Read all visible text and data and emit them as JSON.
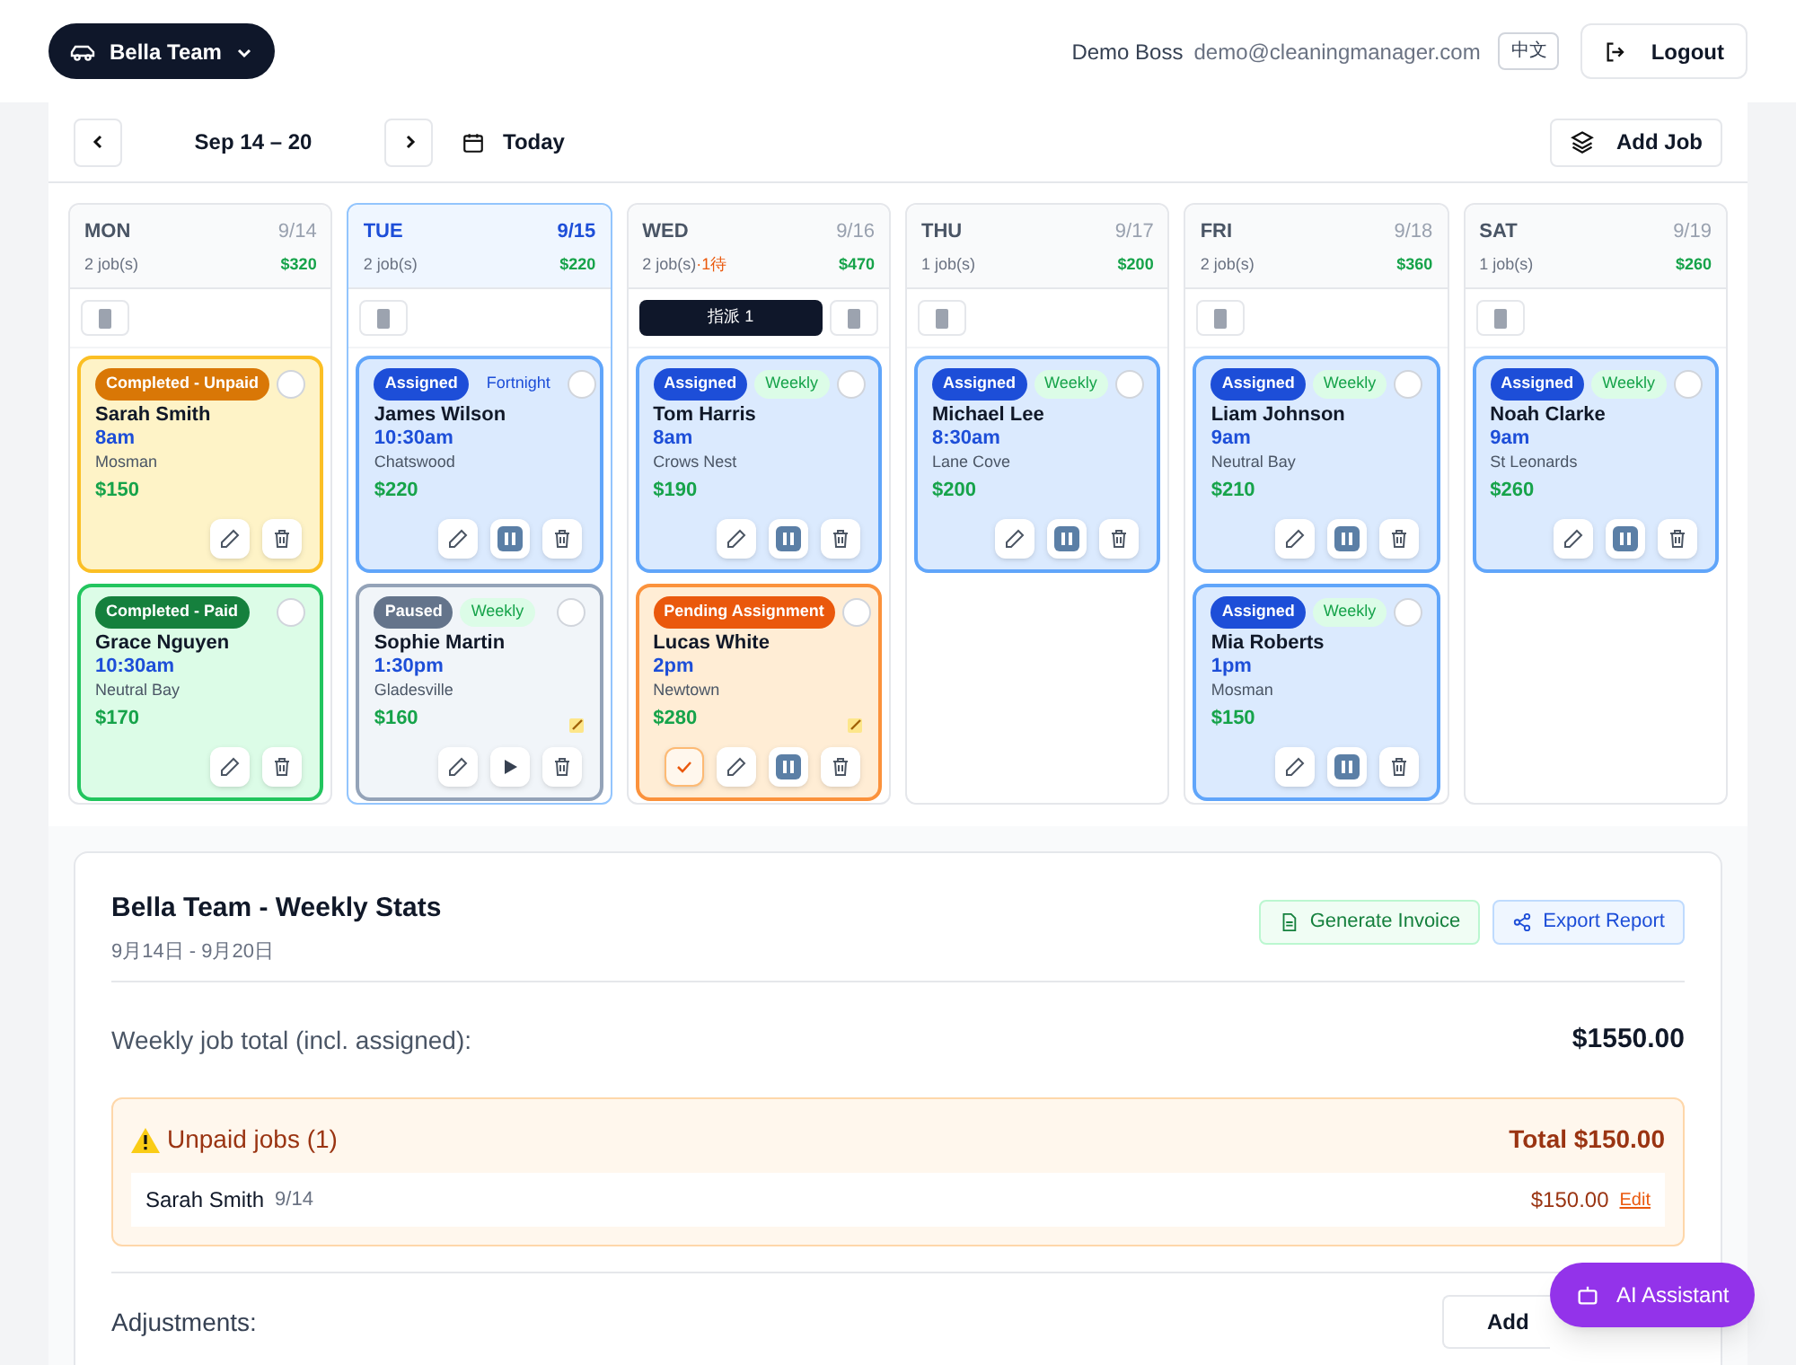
{
  "header": {
    "team": "Bella Team",
    "user": "Demo Boss",
    "email": "demo@cleaningmanager.com",
    "language": "中文",
    "logout": "Logout"
  },
  "toolbar": {
    "range": "Sep 14 – 20",
    "today": "Today",
    "add_job": "Add Job"
  },
  "days": [
    {
      "day": "MON",
      "date": "9/14",
      "jobs": "2 job(s)",
      "total": "$320",
      "selected": false,
      "jobs_list": [
        {
          "kind": "completed_unpaid",
          "status": "Completed - Unpaid",
          "name": "Sarah Smith",
          "time": "8am",
          "suburb": "Mosman",
          "price": "$150",
          "note": false,
          "selected": false,
          "actions": [
            {
              "kind": "edit"
            },
            {
              "kind": "delete"
            }
          ]
        },
        {
          "kind": "completed_paid",
          "status": "Completed - Paid",
          "name": "Grace Nguyen",
          "time": "10:30am",
          "suburb": "Neutral Bay",
          "price": "$170",
          "note": false,
          "selected": false,
          "actions": [
            {
              "kind": "edit"
            },
            {
              "kind": "delete"
            }
          ]
        }
      ]
    },
    {
      "day": "TUE",
      "date": "9/15",
      "jobs": "2 job(s)",
      "total": "$220",
      "selected": true,
      "jobs_list": [
        {
          "kind": "assigned",
          "status": "Assigned",
          "recurrence": "Fortnight",
          "name": "James Wilson",
          "time": "10:30am",
          "suburb": "Chatswood",
          "price": "$220",
          "note": false,
          "selected": false,
          "actions": [
            {
              "kind": "edit"
            },
            {
              "kind": "pause"
            },
            {
              "kind": "delete"
            }
          ]
        },
        {
          "kind": "paused",
          "status": "Paused",
          "recurrence": "Weekly",
          "name": "Sophie Martin",
          "time": "1:30pm",
          "suburb": "Gladesville",
          "price": "$160",
          "note": true,
          "selected": false,
          "actions": [
            {
              "kind": "edit"
            },
            {
              "kind": "play"
            },
            {
              "kind": "delete"
            }
          ]
        }
      ]
    },
    {
      "day": "WED",
      "date": "9/16",
      "jobs": "2 job(s)",
      "pending": "·1待",
      "total": "$470",
      "selected": false,
      "assign": "指派 1",
      "jobs_list": [
        {
          "kind": "assigned",
          "status": "Assigned",
          "recurrence": "Weekly",
          "name": "Tom Harris",
          "time": "8am",
          "suburb": "Crows Nest",
          "price": "$190",
          "note": false,
          "selected": false,
          "actions": [
            {
              "kind": "edit"
            },
            {
              "kind": "pause"
            },
            {
              "kind": "delete"
            }
          ]
        },
        {
          "kind": "pending",
          "status": "Pending Assignment",
          "name": "Lucas White",
          "time": "2pm",
          "suburb": "Newtown",
          "price": "$280",
          "note": true,
          "selected": false,
          "actions": [
            {
              "kind": "approve"
            },
            {
              "kind": "edit"
            },
            {
              "kind": "pause"
            },
            {
              "kind": "delete"
            }
          ]
        }
      ]
    },
    {
      "day": "THU",
      "date": "9/17",
      "jobs": "1 job(s)",
      "total": "$200",
      "selected": false,
      "jobs_list": [
        {
          "kind": "assigned",
          "status": "Assigned",
          "recurrence": "Weekly",
          "name": "Michael Lee",
          "time": "8:30am",
          "suburb": "Lane Cove",
          "price": "$200",
          "note": false,
          "selected": false,
          "actions": [
            {
              "kind": "edit"
            },
            {
              "kind": "pause"
            },
            {
              "kind": "delete"
            }
          ]
        }
      ]
    },
    {
      "day": "FRI",
      "date": "9/18",
      "jobs": "2 job(s)",
      "total": "$360",
      "selected": false,
      "jobs_list": [
        {
          "kind": "assigned",
          "status": "Assigned",
          "recurrence": "Weekly",
          "name": "Liam Johnson",
          "time": "9am",
          "suburb": "Neutral Bay",
          "price": "$210",
          "note": false,
          "selected": false,
          "actions": [
            {
              "kind": "edit"
            },
            {
              "kind": "pause"
            },
            {
              "kind": "delete"
            }
          ]
        },
        {
          "kind": "assigned",
          "status": "Assigned",
          "recurrence": "Weekly",
          "name": "Mia Roberts",
          "time": "1pm",
          "suburb": "Mosman",
          "price": "$150",
          "note": false,
          "selected": false,
          "actions": [
            {
              "kind": "edit"
            },
            {
              "kind": "pause"
            },
            {
              "kind": "delete"
            }
          ]
        }
      ]
    },
    {
      "day": "SAT",
      "date": "9/19",
      "jobs": "1 job(s)",
      "total": "$260",
      "selected": false,
      "jobs_list": [
        {
          "kind": "assigned",
          "status": "Assigned",
          "recurrence": "Weekly",
          "name": "Noah Clarke",
          "time": "9am",
          "suburb": "St Leonards",
          "price": "$260",
          "note": false,
          "selected": false,
          "actions": [
            {
              "kind": "edit"
            },
            {
              "kind": "pause"
            },
            {
              "kind": "delete"
            }
          ]
        }
      ]
    }
  ],
  "stats": {
    "title": "Bella Team - Weekly Stats",
    "range": "9月14日 - 9月20日",
    "generate_invoice": "Generate Invoice",
    "export_report": "Export Report",
    "total_label": "Weekly job total (incl. assigned):",
    "total_value": "$1550.00",
    "unpaid": {
      "title": "Unpaid jobs (1)",
      "total": "Total $150.00",
      "rows": [
        {
          "name": "Sarah Smith",
          "date": "9/14",
          "amount": "$150.00",
          "action": "Edit"
        }
      ]
    },
    "adjustments_label": "Adjustments:",
    "add_adjustment": "Add"
  },
  "assistant": "AI Assistant"
}
